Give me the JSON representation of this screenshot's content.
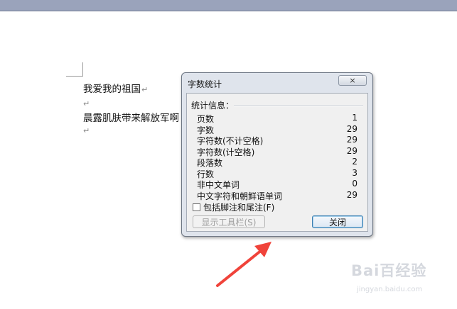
{
  "document": {
    "lines": [
      "我爱我的祖国",
      "晨露肌肤带来解放军啊"
    ],
    "paragraph_mark": "↵"
  },
  "dialog": {
    "title": "字数统计",
    "group_label": "统计信息：",
    "stats": [
      {
        "label": "页数",
        "value": "1"
      },
      {
        "label": "字数",
        "value": "29"
      },
      {
        "label": "字符数(不计空格)",
        "value": "29"
      },
      {
        "label": "字符数(计空格)",
        "value": "29"
      },
      {
        "label": "段落数",
        "value": "2"
      },
      {
        "label": "行数",
        "value": "3"
      },
      {
        "label": "非中文单词",
        "value": "0"
      },
      {
        "label": "中文字符和朝鲜语单词",
        "value": "29"
      }
    ],
    "checkbox_label": "包括脚注和尾注(F)",
    "checkbox_checked": false,
    "toolbar_button": "显示工具栏(S)",
    "close_button": "关闭",
    "close_icon": "×"
  },
  "watermark": {
    "logo": "Bai百经验",
    "url": "jingyan.baidu.com"
  },
  "colors": {
    "arrow": "#f0433a",
    "titlebar": "#9aa3bb",
    "dialog_bg": "#dfe4ec"
  }
}
